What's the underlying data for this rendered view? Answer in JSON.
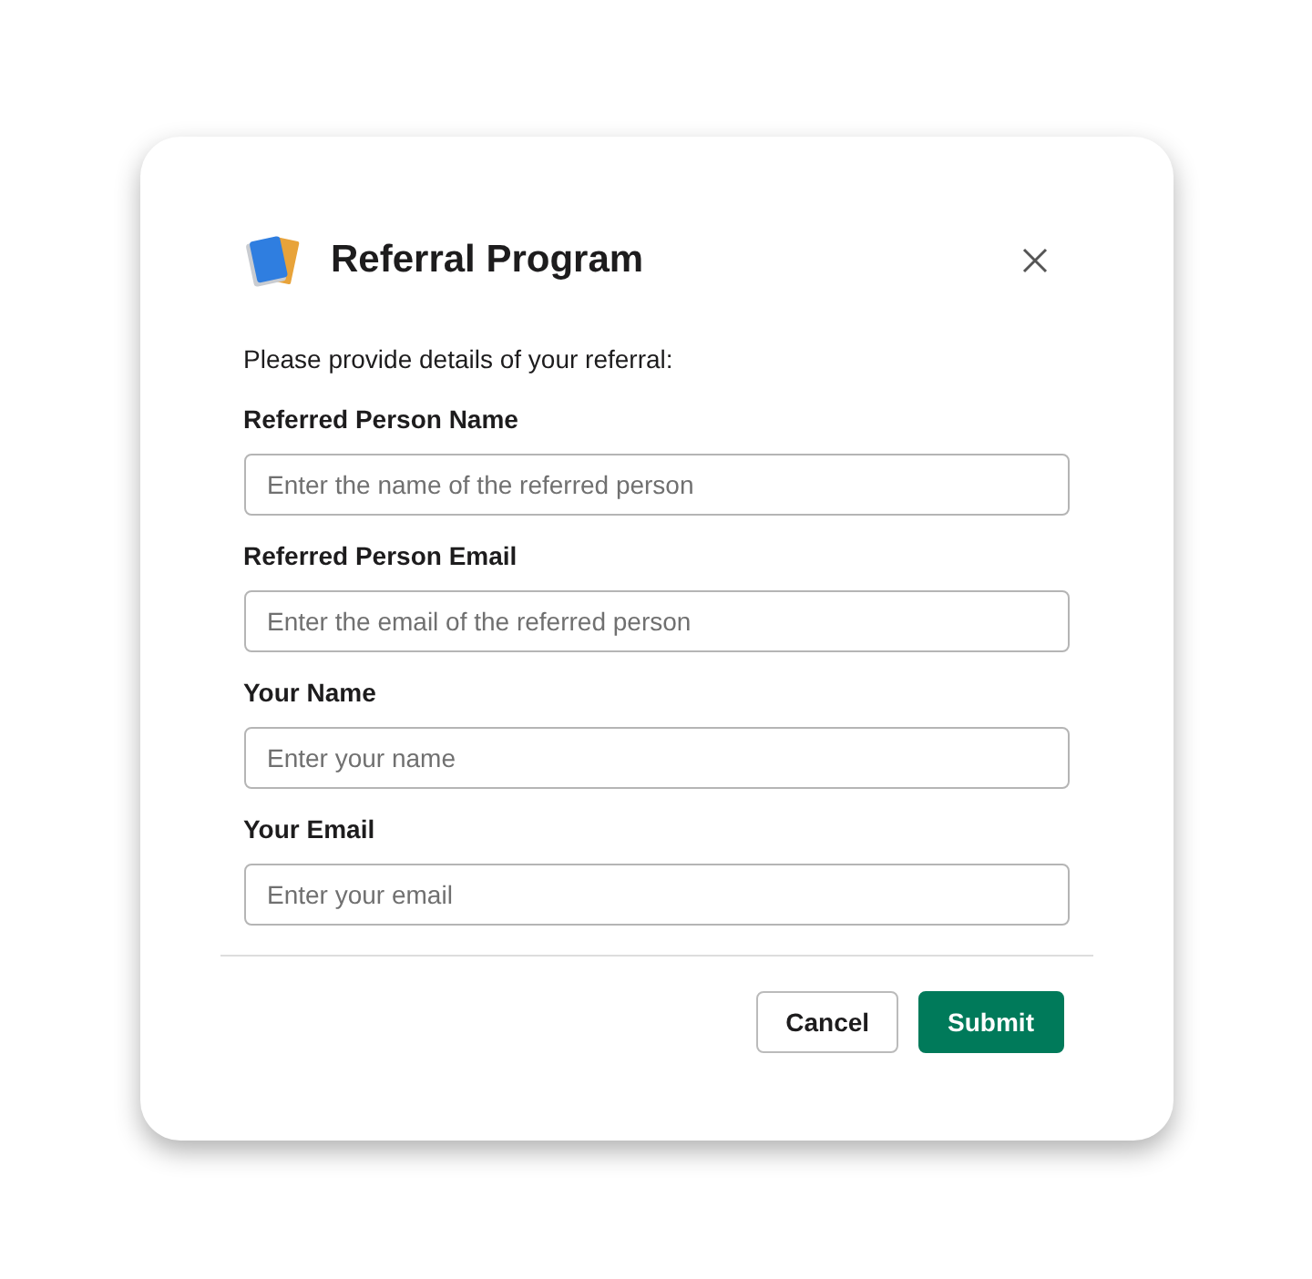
{
  "dialog": {
    "title": "Referral Program",
    "intro": "Please provide details of your referral:",
    "fields": [
      {
        "label": "Referred Person Name",
        "placeholder": "Enter the name of the referred person"
      },
      {
        "label": "Referred Person Email",
        "placeholder": "Enter the email of the referred person"
      },
      {
        "label": "Your Name",
        "placeholder": "Enter your name"
      },
      {
        "label": "Your Email",
        "placeholder": "Enter your email"
      }
    ],
    "buttons": [
      {
        "label": "Cancel",
        "kind": "secondary"
      },
      {
        "label": "Submit",
        "kind": "primary"
      }
    ]
  }
}
